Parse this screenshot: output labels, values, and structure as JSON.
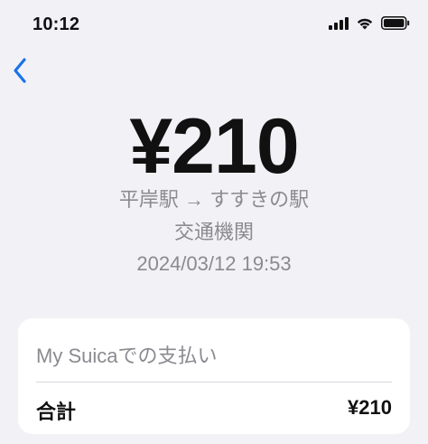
{
  "status_bar": {
    "time": "10:12",
    "icons": [
      "signal-icon",
      "wifi-icon",
      "battery-icon"
    ]
  },
  "nav": {
    "back_icon": "chevron-left-icon",
    "accent_color": "#1a73e8"
  },
  "transaction": {
    "amount": "¥210",
    "route": "平岸駅 → すすきの駅",
    "category": "交通機関",
    "timestamp": "2024/03/12 19:53"
  },
  "payment_card": {
    "header": "My Suicaでの支払い",
    "total_label": "合計",
    "total_value": "¥210"
  }
}
